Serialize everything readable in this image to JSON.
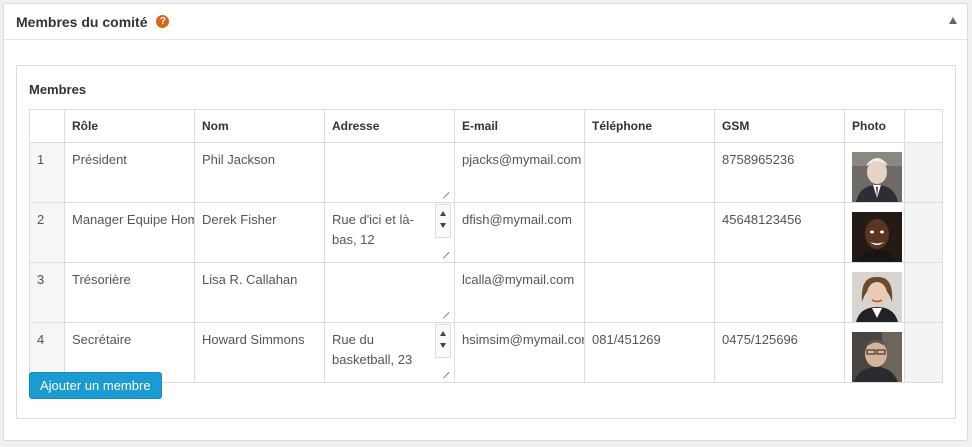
{
  "panel": {
    "title": "Membres du comité",
    "help_icon": "question-circle-icon",
    "collapse_icon": "caret-up-icon"
  },
  "section": {
    "title": "Membres"
  },
  "table": {
    "columns": [
      "Rôle",
      "Nom",
      "Adresse",
      "E-mail",
      "Téléphone",
      "GSM",
      "Photo"
    ],
    "rows": [
      {
        "num": "1",
        "role": "Président",
        "nom": "Phil Jackson",
        "adresse": "",
        "email": "pjacks@mymail.com",
        "telephone": "",
        "gsm": "8758965236",
        "photo": "person-photo-icon"
      },
      {
        "num": "2",
        "role": "Manager Equipe Hommes",
        "nom": "Derek Fisher",
        "adresse": "Rue d'ici et là-bas, 12",
        "email": "dfish@mymail.com",
        "telephone": "",
        "gsm": "45648123456",
        "photo": "person-photo-icon"
      },
      {
        "num": "3",
        "role": "Trésorière",
        "nom": "Lisa R. Callahan",
        "adresse": "",
        "email": "lcalla@mymail.com",
        "telephone": "",
        "gsm": "",
        "photo": "person-photo-icon"
      },
      {
        "num": "4",
        "role": "Secrétaire",
        "nom": "Howard Simmons",
        "adresse": "Rue du basketball, 23",
        "email": "hsimsim@mymail.com",
        "telephone": "081/451269",
        "gsm": "0475/125696",
        "photo": "person-photo-icon"
      }
    ]
  },
  "actions": {
    "add_label": "Ajouter un membre"
  },
  "colors": {
    "accent": "#1a9bd1",
    "help": "#d4691e"
  }
}
